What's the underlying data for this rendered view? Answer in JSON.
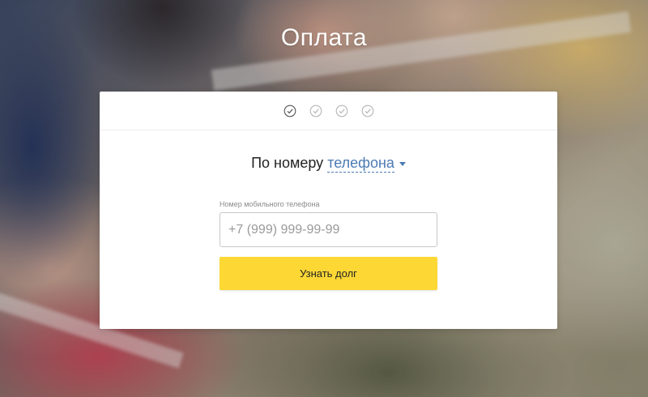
{
  "page": {
    "title": "Оплата"
  },
  "steps": {
    "items": [
      {
        "state": "active"
      },
      {
        "state": "inactive"
      },
      {
        "state": "inactive"
      },
      {
        "state": "inactive"
      }
    ],
    "icon": "check-circle-icon",
    "colors": {
      "active": "#555555",
      "inactive": "#b5b5b5"
    }
  },
  "form": {
    "heading_prefix": "По номеру",
    "mode_label": "телефона",
    "phone_label": "Номер мобильного телефона",
    "phone_placeholder": "+7 (999) 999-99-99",
    "phone_value": "",
    "submit_label": "Узнать долг"
  },
  "colors": {
    "accent_button": "#fdd835",
    "link": "#4b7ab3"
  }
}
